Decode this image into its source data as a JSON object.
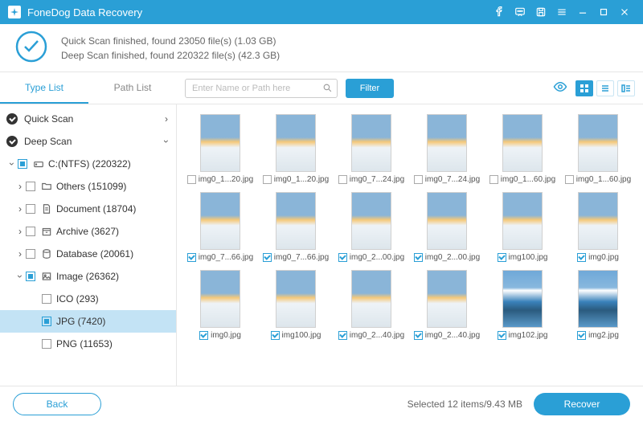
{
  "app_title": "FoneDog Data Recovery",
  "status": {
    "quick": "Quick Scan finished, found 23050 file(s) (1.03 GB)",
    "deep": "Deep Scan finished, found 220322 file(s) (42.3 GB)"
  },
  "tabs": {
    "type_list": "Type List",
    "path_list": "Path List"
  },
  "search": {
    "placeholder": "Enter Name or Path here"
  },
  "filter_label": "Filter",
  "tree": {
    "quick_scan": "Quick Scan",
    "deep_scan": "Deep Scan",
    "drive": "C:(NTFS) (220322)",
    "others": "Others (151099)",
    "document": "Document (18704)",
    "archive": "Archive (3627)",
    "database": "Database (20061)",
    "image": "Image (26362)",
    "ico": "ICO (293)",
    "jpg": "JPG (7420)",
    "png": "PNG (11653)"
  },
  "files": [
    [
      {
        "name": "img0_1...20.jpg",
        "checked": false,
        "alt": false
      },
      {
        "name": "img0_1...20.jpg",
        "checked": false,
        "alt": false
      },
      {
        "name": "img0_7...24.jpg",
        "checked": false,
        "alt": false
      },
      {
        "name": "img0_7...24.jpg",
        "checked": false,
        "alt": false
      },
      {
        "name": "img0_1...60.jpg",
        "checked": false,
        "alt": false
      },
      {
        "name": "img0_1...60.jpg",
        "checked": false,
        "alt": false
      }
    ],
    [
      {
        "name": "img0_7...66.jpg",
        "checked": true,
        "alt": false
      },
      {
        "name": "img0_7...66.jpg",
        "checked": true,
        "alt": false
      },
      {
        "name": "img0_2...00.jpg",
        "checked": true,
        "alt": false
      },
      {
        "name": "img0_2...00.jpg",
        "checked": true,
        "alt": false
      },
      {
        "name": "img100.jpg",
        "checked": true,
        "alt": false
      },
      {
        "name": "img0.jpg",
        "checked": true,
        "alt": false
      }
    ],
    [
      {
        "name": "img0.jpg",
        "checked": true,
        "alt": false
      },
      {
        "name": "img100.jpg",
        "checked": true,
        "alt": false
      },
      {
        "name": "img0_2...40.jpg",
        "checked": true,
        "alt": false
      },
      {
        "name": "img0_2...40.jpg",
        "checked": true,
        "alt": false
      },
      {
        "name": "img102.jpg",
        "checked": true,
        "alt": true
      },
      {
        "name": "img2.jpg",
        "checked": true,
        "alt": true
      }
    ]
  ],
  "footer": {
    "back": "Back",
    "selected": "Selected 12 items/9.43 MB",
    "recover": "Recover"
  }
}
